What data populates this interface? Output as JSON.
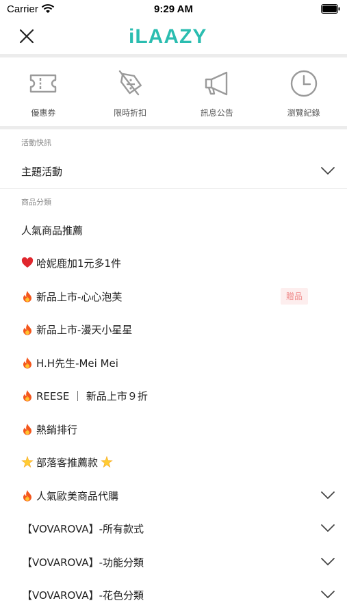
{
  "status_bar": {
    "carrier": "Carrier",
    "time": "9:29 AM"
  },
  "header": {
    "logo": "iLAAZY"
  },
  "shortcuts": [
    {
      "label": "優惠券",
      "icon": "ticket-icon"
    },
    {
      "label": "限時折扣",
      "icon": "discount-tag-icon"
    },
    {
      "label": "訊息公告",
      "icon": "megaphone-icon"
    },
    {
      "label": "瀏覽紀錄",
      "icon": "clock-icon"
    }
  ],
  "section_events": {
    "label": "活動快訊",
    "items": [
      {
        "label": "主題活動",
        "expandable": true
      }
    ]
  },
  "section_categories": {
    "label": "商品分類",
    "items": [
      {
        "label": "人氣商品推薦",
        "icon": "",
        "expandable": false
      },
      {
        "label": "哈妮鹿加1元多1件",
        "icon": "heart-icon",
        "expandable": false
      },
      {
        "label": "新品上市-心心泡芙",
        "icon": "fire-icon",
        "expandable": false,
        "badge": "贈品"
      },
      {
        "label": "新品上市-漫天小星星",
        "icon": "fire-icon",
        "expandable": false
      },
      {
        "label": "H.H先生-Mei Mei",
        "icon": "fire-icon",
        "expandable": false
      },
      {
        "label": "REESE ｜ 新品上市９折",
        "icon": "fire-icon",
        "expandable": false
      },
      {
        "label": "熱銷排行",
        "icon": "fire-icon",
        "expandable": false
      },
      {
        "label": "部落客推薦款",
        "icon": "sparkle-star-icon",
        "expandable": false
      },
      {
        "label": "人氣歐美商品代購",
        "icon": "fire-icon",
        "expandable": true
      },
      {
        "label": "【VOVAROVA】-所有款式",
        "icon": "",
        "expandable": true
      },
      {
        "label": "【VOVAROVA】-功能分類",
        "icon": "",
        "expandable": true
      },
      {
        "label": "【VOVAROVA】-花色分類",
        "icon": "",
        "expandable": true
      }
    ]
  },
  "colors": {
    "brand": "#2bbdb0",
    "badge_bg": "#fdeeee",
    "badge_text": "#f08c8c"
  }
}
